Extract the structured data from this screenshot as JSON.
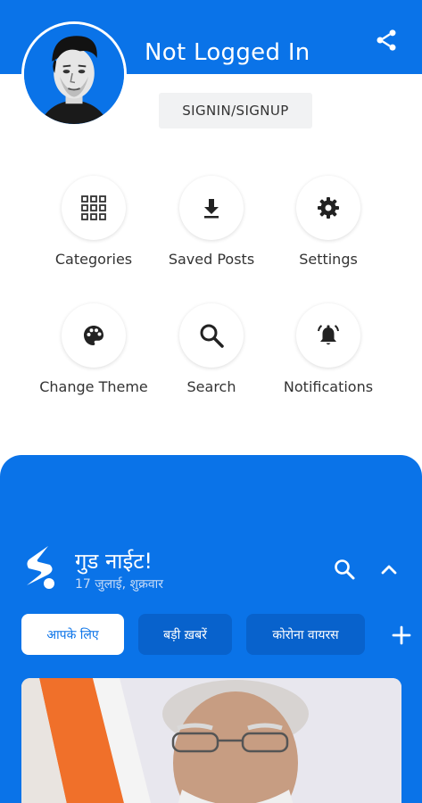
{
  "header": {
    "user_name": "Not Logged In",
    "signin_label": "SIGNIN/SIGNUP",
    "share_icon": "share-icon",
    "avatar": "avatar-illustration"
  },
  "menu": {
    "items": [
      {
        "label": "Categories",
        "icon": "grid-icon"
      },
      {
        "label": "Saved Posts",
        "icon": "download-icon"
      },
      {
        "label": "Settings",
        "icon": "gear-icon"
      },
      {
        "label": "Change Theme",
        "icon": "palette-icon"
      },
      {
        "label": "Search",
        "icon": "search-icon"
      },
      {
        "label": "Notifications",
        "icon": "alarm-bell-icon"
      }
    ]
  },
  "panel": {
    "greeting": "गुड नाईट!",
    "date": "17 जुलाई, शुक्रवार",
    "search_icon": "search-icon",
    "collapse_icon": "chevron-up-icon",
    "tabs": [
      {
        "label": "आपके लिए",
        "active": true
      },
      {
        "label": "बड़ी ख़बरें",
        "active": false
      },
      {
        "label": "कोरोना वायरस",
        "active": false
      }
    ],
    "add_icon": "plus-icon"
  },
  "colors": {
    "primary": "#0a73e8",
    "chip_dark": "#0862cc",
    "text_dark": "#333333",
    "button_bg": "#f1f2f3"
  }
}
